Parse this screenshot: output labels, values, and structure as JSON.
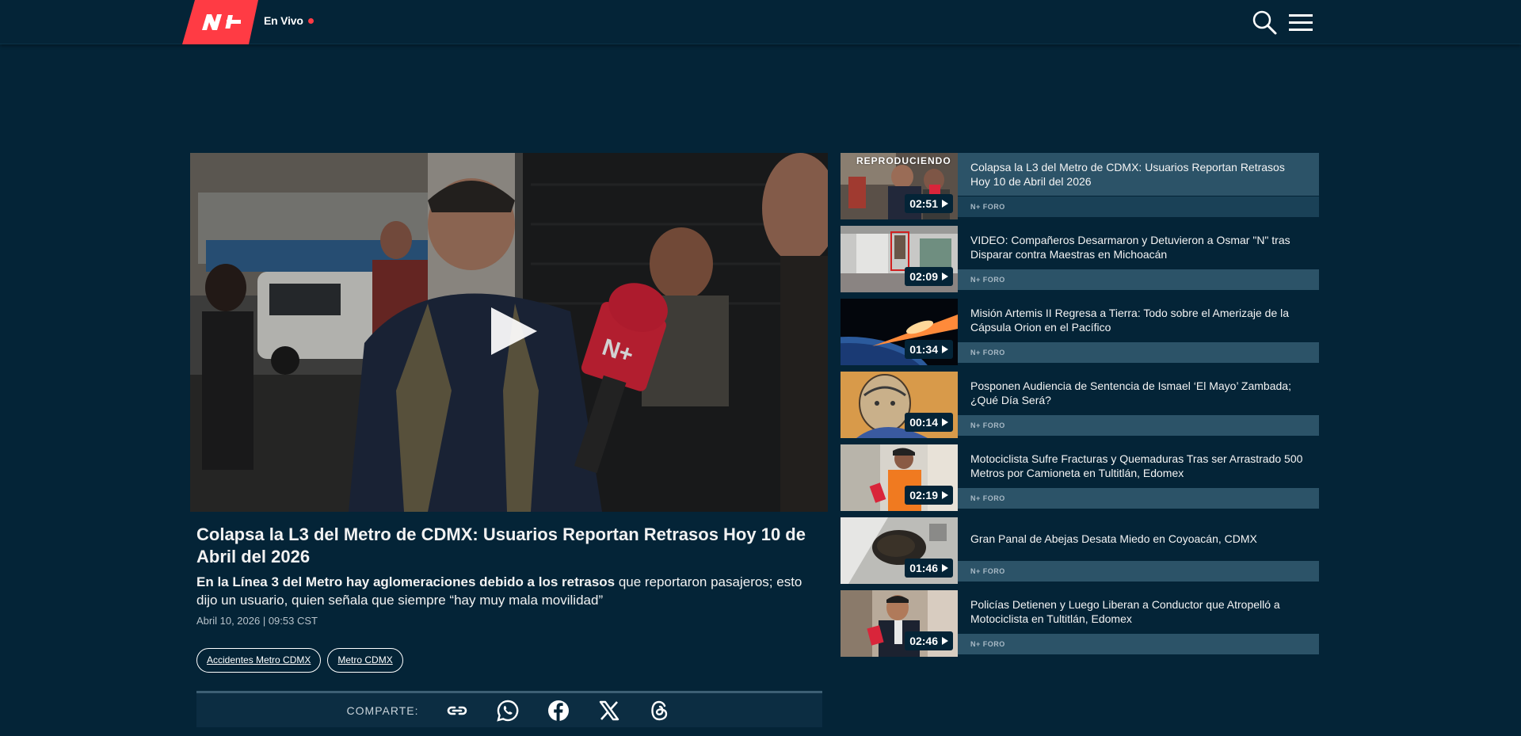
{
  "header": {
    "logo_text": "N+",
    "live_label": "En Vivo",
    "brand_red": "#ff3b44",
    "background": "#042437"
  },
  "video": {
    "title": "Colapsa la L3 del Metro de CDMX: Usuarios Reportan Retrasos Hoy 10 de Abril del 2026",
    "summary_bold": "En la Línea 3 del Metro hay aglomeraciones debido a los retrasos",
    "summary_rest": " que reportaron pasajeros; esto dijo un usuario, quien señala que siempre “hay muy mala movilidad”",
    "date": "Abril 10, 2026 | 09:53 CST",
    "tags": [
      "Accidentes Metro CDMX",
      "Metro CDMX"
    ]
  },
  "share": {
    "label": "COMPARTE:",
    "icons": [
      "link-icon",
      "whatsapp-icon",
      "facebook-icon",
      "x-icon",
      "threads-icon"
    ]
  },
  "playlist": {
    "now_playing_label": "REPRODUCIENDO",
    "items": [
      {
        "title": "Colapsa la L3 del Metro de CDMX: Usuarios Reportan Retrasos Hoy 10 de Abril del 2026",
        "duration": "02:51",
        "source": "N+ FORO"
      },
      {
        "title": "VIDEO: Compañeros Desarmaron y Detuvieron a Osmar \"N\" tras Disparar contra Maestras en Michoacán",
        "duration": "02:09",
        "source": "N+ FORO"
      },
      {
        "title": "Misión Artemis II Regresa a Tierra: Todo sobre el Amerizaje de la Cápsula Orion en el Pacífico",
        "duration": "01:34",
        "source": "N+ FORO"
      },
      {
        "title": "Posponen Audiencia de Sentencia de Ismael ‘El Mayo’ Zambada; ¿Qué Día Será?",
        "duration": "00:14",
        "source": "N+ FORO"
      },
      {
        "title": "Motociclista Sufre Fracturas y Quemaduras Tras ser Arrastrado 500 Metros por Camioneta en Tultitlán, Edomex",
        "duration": "02:19",
        "source": "N+ FORO"
      },
      {
        "title": "Gran Panal de Abejas Desata Miedo en Coyoacán, CDMX",
        "duration": "01:46",
        "source": "N+ FORO"
      },
      {
        "title": "Policías Detienen y Luego Liberan a Conductor que Atropelló a Motociclista en Tultitlán, Edomex",
        "duration": "02:46",
        "source": "N+ FORO"
      }
    ]
  }
}
